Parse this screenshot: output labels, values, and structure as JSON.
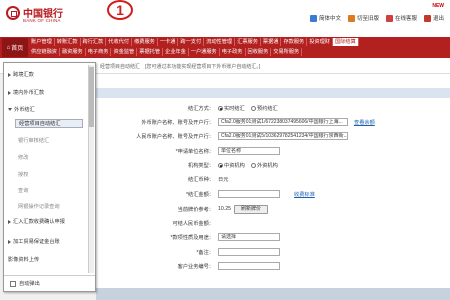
{
  "brand": {
    "name_cn": "中国银行",
    "name_en": "BANK OF CHINA"
  },
  "badge": "1",
  "top_links": [
    {
      "label": "简体中文",
      "icon": "chinese-icon",
      "color": "#3b7bd4"
    },
    {
      "label": "切至旧版",
      "icon": "switch-icon",
      "color": "#e07a1f"
    },
    {
      "label": "在线客服",
      "icon": "service-icon",
      "color": "#d04040"
    },
    {
      "label": "退出",
      "icon": "exit-icon",
      "color": "#c0392b"
    }
  ],
  "new_tag": "NEW",
  "nav": {
    "home": "首页",
    "row1": [
      "账户管理",
      "转账汇款",
      "跨行汇款",
      "代收代付",
      "缴费服务",
      "一卡通",
      "跨一支付",
      "流动性管理",
      "汇票服务",
      "票据通",
      "存款服务",
      "投资理财",
      "国际结算"
    ],
    "row2": [
      "供应链融资",
      "融资服务",
      "电子商务",
      "资金监管",
      "票据托管",
      "企业年金",
      "一户通服务",
      "电子政务",
      "回收服务",
      "交易所服务"
    ],
    "active": "国际结算"
  },
  "subbar": {
    "location": "经营项目自动结汇",
    "hint": "[您可通过本功能实现经营项目下外币账户自动结汇。]"
  },
  "menu": {
    "items": [
      {
        "label": "跨境汇款",
        "expanded": false
      },
      {
        "label": "境内外币汇款",
        "expanded": false
      },
      {
        "label": "外币结汇",
        "expanded": true
      }
    ],
    "sub_items": [
      "经营项目自动结汇",
      "银行审核结汇",
      "修改",
      "授权",
      "查询",
      "网银操作记录查询"
    ],
    "active_sub": "经营项目自动结汇",
    "more_items": [
      "汇入汇款收费确认申报",
      "加工贸易保证金台账",
      "影像资料上传"
    ],
    "footer": "自动弹出"
  },
  "form": {
    "rows": [
      {
        "label": "结汇方式：",
        "type": "radio",
        "options": [
          "实时结汇",
          "预约结汇"
        ],
        "selected": 0
      },
      {
        "label": "外币账户名称、账号及开户行：",
        "type": "select",
        "value": "Cfa2.0服务01测试1/67223803749560​6/中国银行上海...",
        "link": "查看余额"
      },
      {
        "label": "人民币账户名称、账号及开户行：",
        "type": "select",
        "value": "Cfa2.0服务01测试5/103629782541234/中国银行京西街..."
      },
      {
        "label": "*申请单位名称：",
        "type": "text",
        "value": "单位名称"
      },
      {
        "label": "机构类型：",
        "type": "radio",
        "options": [
          "中资机构",
          "外资机构"
        ],
        "selected": 0
      },
      {
        "label": "结汇币种：",
        "type": "static",
        "value": "日元"
      },
      {
        "label": "*结汇金额：",
        "type": "input",
        "value": "",
        "link": "收费标准"
      },
      {
        "label": "当前牌价参考：",
        "type": "rate",
        "value": "10.25",
        "button": "刷新牌价"
      },
      {
        "label": "可结人民币金额：",
        "type": "static",
        "value": ""
      },
      {
        "label": "*款项性质及用途：",
        "type": "select",
        "value": "请选择"
      },
      {
        "label": "*备注：",
        "type": "input",
        "value": ""
      },
      {
        "label": "客户业务编号：",
        "type": "input",
        "value": ""
      }
    ]
  }
}
